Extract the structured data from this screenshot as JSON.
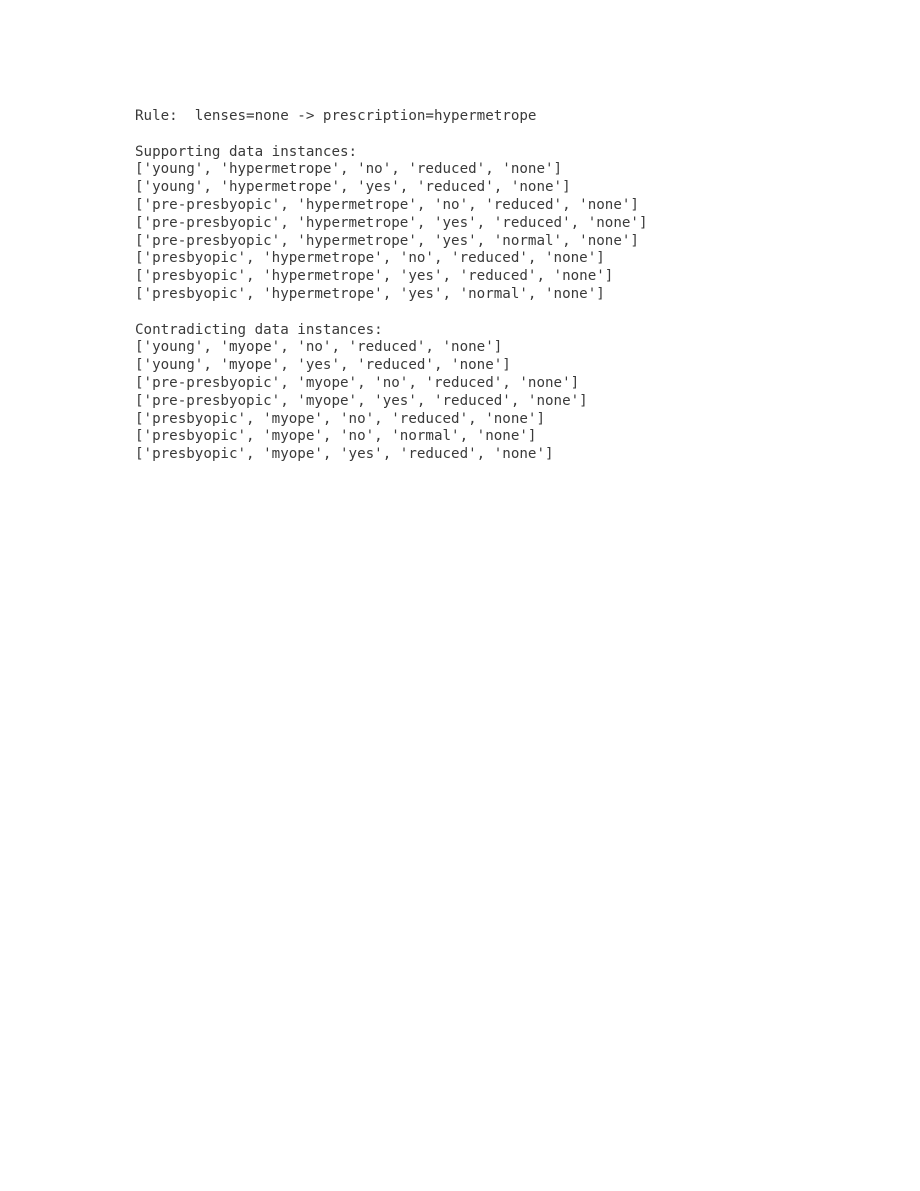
{
  "document": {
    "rule_label": "Rule:",
    "rule_line": "Rule:  lenses=none -> prescription=hypermetrope",
    "rule": {
      "antecedent": "lenses=none",
      "arrow": "->",
      "consequent": "prescription=hypermetrope"
    },
    "sections": [
      {
        "heading": "Supporting data instances:",
        "instances": [
          "['young', 'hypermetrope', 'no', 'reduced', 'none']",
          "['young', 'hypermetrope', 'yes', 'reduced', 'none']",
          "['pre-presbyopic', 'hypermetrope', 'no', 'reduced', 'none']",
          "['pre-presbyopic', 'hypermetrope', 'yes', 'reduced', 'none']",
          "['pre-presbyopic', 'hypermetrope', 'yes', 'normal', 'none']",
          "['presbyopic', 'hypermetrope', 'no', 'reduced', 'none']",
          "['presbyopic', 'hypermetrope', 'yes', 'reduced', 'none']",
          "['presbyopic', 'hypermetrope', 'yes', 'normal', 'none']"
        ],
        "count": 8
      },
      {
        "heading": "Contradicting data instances:",
        "instances": [
          "['young', 'myope', 'no', 'reduced', 'none']",
          "['young', 'myope', 'yes', 'reduced', 'none']",
          "['pre-presbyopic', 'myope', 'no', 'reduced', 'none']",
          "['pre-presbyopic', 'myope', 'yes', 'reduced', 'none']",
          "['presbyopic', 'myope', 'no', 'reduced', 'none']",
          "['presbyopic', 'myope', 'no', 'normal', 'none']",
          "['presbyopic', 'myope', 'yes', 'reduced', 'none']"
        ],
        "count": 7
      }
    ]
  },
  "colors": {
    "text": "#3a3a3a",
    "background": "#ffffff"
  }
}
